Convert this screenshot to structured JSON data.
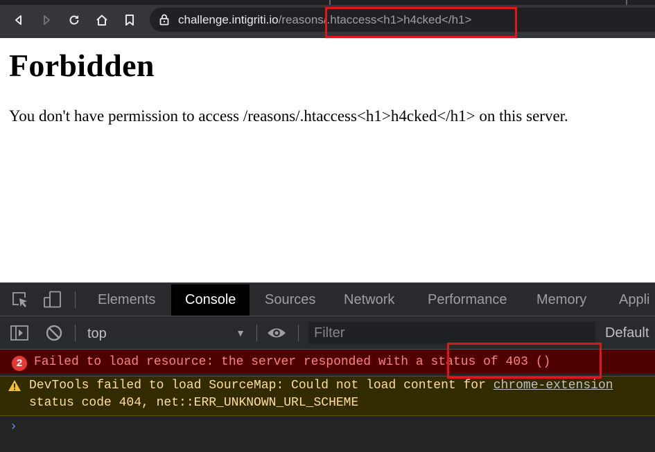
{
  "browser": {
    "url_host": "challenge.intigriti.io",
    "url_path": "/reasons/.htaccess<h1>h4cked</h1>",
    "icons": [
      "back-icon",
      "forward-icon",
      "reload-icon",
      "home-icon",
      "bookmark-icon",
      "lock-icon"
    ]
  },
  "page": {
    "heading": "Forbidden",
    "message": "You don't have permission to access /reasons/.htaccess<h1>h4cked</h1> on this server."
  },
  "devtools": {
    "tabs": [
      "Elements",
      "Console",
      "Sources",
      "Network",
      "Performance",
      "Memory",
      "Appli"
    ],
    "active_tab": "Console",
    "context": "top",
    "filter_placeholder": "Filter",
    "levels_label": "Default",
    "error": {
      "count": "2",
      "text": "Failed to load resource: the server responded with a status of 403 ()"
    },
    "warning": {
      "text_before_link": "DevTools failed to load SourceMap: Could not load content for ",
      "link": "chrome-extension",
      "line2": "status code 404, net::ERR_UNKNOWN_URL_SCHEME"
    },
    "prompt": "›"
  },
  "colors": {
    "toolbar": "#35363a",
    "omnibox": "#202124",
    "highlight": "#e0161b",
    "error_bg": "#4e0000",
    "error_text": "#ff8080",
    "warn_bg": "#332b00",
    "warn_text": "#ffdd9e"
  }
}
